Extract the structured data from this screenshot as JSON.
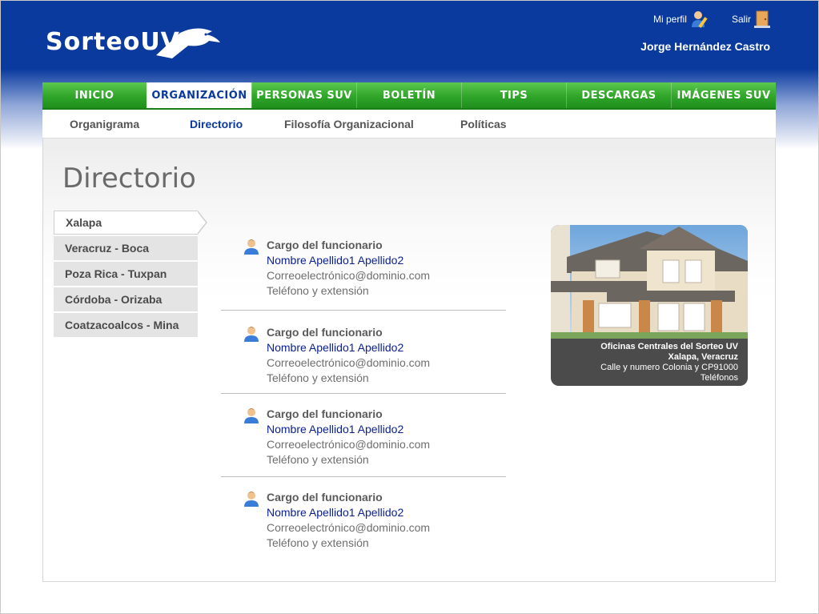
{
  "header": {
    "logo_text": "Sorteo",
    "logo_mark": "UV",
    "profile_label": "Mi perfil",
    "logout_label": "Salir",
    "user_name": "Jorge Hernández Castro"
  },
  "main_nav": {
    "items": [
      {
        "label": "INICIO"
      },
      {
        "label": "ORGANIZACIÓN",
        "active": true
      },
      {
        "label": "PERSONAS SUV"
      },
      {
        "label": "BOLETÍN"
      },
      {
        "label": "TIPS"
      },
      {
        "label": "DESCARGAS"
      },
      {
        "label": "IMÁGENES SUV"
      }
    ]
  },
  "sub_nav": {
    "items": [
      {
        "label": "Organigrama"
      },
      {
        "label": "Directorio",
        "active": true
      },
      {
        "label": "Filosofía Organizacional"
      },
      {
        "label": "Políticas"
      }
    ]
  },
  "page": {
    "title": "Directorio"
  },
  "cities": [
    {
      "label": "Xalapa",
      "active": true
    },
    {
      "label": "Veracruz - Boca"
    },
    {
      "label": "Poza Rica - Tuxpan"
    },
    {
      "label": "Córdoba - Orizaba"
    },
    {
      "label": "Coatzacoalcos - Mina"
    }
  ],
  "directory": [
    {
      "position": "Cargo del funcionario",
      "name": "Nombre Apellido1 Apellido2",
      "email": "Correoelectrónico@dominio.com",
      "phone": "Teléfono y extensión"
    },
    {
      "position": "Cargo del funcionario",
      "name": "Nombre Apellido1 Apellido2",
      "email": "Correoelectrónico@dominio.com",
      "phone": "Teléfono y extensión"
    },
    {
      "position": "Cargo del funcionario",
      "name": "Nombre Apellido1 Apellido2",
      "email": "Correoelectrónico@dominio.com",
      "phone": "Teléfono y extensión"
    },
    {
      "position": "Cargo del funcionario",
      "name": "Nombre Apellido1 Apellido2",
      "email": "Correoelectrónico@dominio.com",
      "phone": "Teléfono y extensión"
    }
  ],
  "office": {
    "title": "Oficinas Centrales del Sorteo UV",
    "city": "Xalapa, Veracruz",
    "address": "Calle y numero Colonia y CP91000",
    "phones": "Teléfonos"
  },
  "colors": {
    "brand_blue": "#0a3a9e",
    "nav_green": "#2fa52a",
    "link_blue": "#0a1f8f"
  },
  "icons": {
    "profile": "user-pencil-icon",
    "logout": "door-icon",
    "person": "person-icon"
  }
}
